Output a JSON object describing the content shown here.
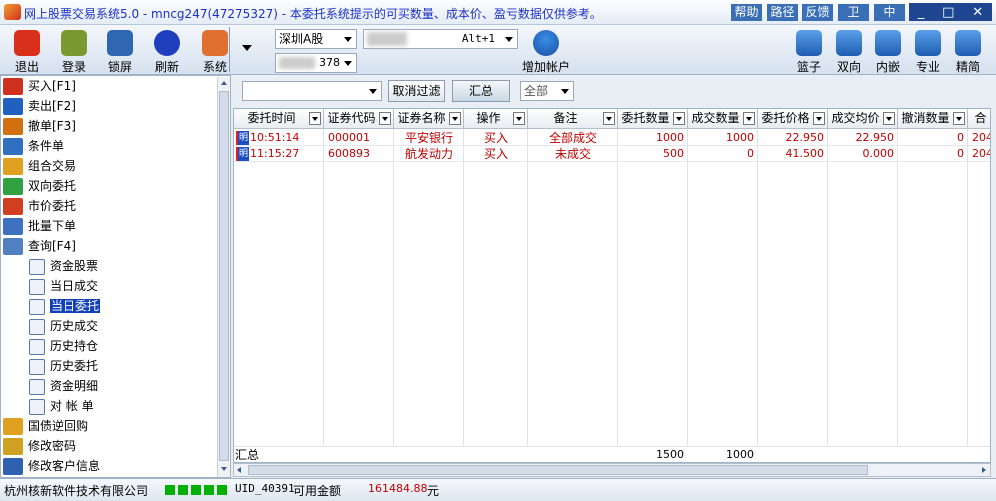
{
  "window": {
    "title": "网上股票交易系统5.0 - mncg247(47275327) - 本委托系统提示的可买数量、成本价、盈亏数据仅供参考。",
    "top_buttons": [
      "帮助",
      "路径",
      "反馈",
      "卫",
      "中"
    ],
    "controls": [
      "_",
      "□",
      "✕"
    ]
  },
  "toolbar": {
    "left": [
      {
        "label": "退出",
        "icon": "power-icon",
        "color": "#d9301c"
      },
      {
        "label": "登录",
        "icon": "users-icon",
        "color": "#7a9a30"
      },
      {
        "label": "锁屏",
        "icon": "lock-icon",
        "color": "#2f67b5"
      },
      {
        "label": "刷新",
        "icon": "refresh-icon",
        "color": "#1f3fbf"
      },
      {
        "label": "系统",
        "icon": "tools-icon",
        "color": "#e07030"
      }
    ],
    "market_select": "深圳A股",
    "account_hotkey": "Alt+1",
    "account_suffix": "378",
    "add_account": "增加帐户",
    "right": [
      {
        "label": "篮子",
        "icon": "basket-icon"
      },
      {
        "label": "双向",
        "icon": "arrows-icon"
      },
      {
        "label": "内嵌",
        "icon": "layers-icon"
      },
      {
        "label": "专业",
        "icon": "user-key-icon"
      },
      {
        "label": "精简",
        "icon": "window-icon"
      }
    ]
  },
  "sidebar": {
    "items": [
      {
        "label": "买入[F1]",
        "icon": "buy-icon",
        "color": "#d03020"
      },
      {
        "label": "卖出[F2]",
        "icon": "sell-icon",
        "color": "#2060c0"
      },
      {
        "label": "撤单[F3]",
        "icon": "hand-icon",
        "color": "#d07010"
      },
      {
        "label": "条件单",
        "icon": "note-icon",
        "color": "#3070c0"
      },
      {
        "label": "组合交易",
        "icon": "combo-icon",
        "color": "#e0a020"
      },
      {
        "label": "双向委托",
        "icon": "two-way-icon",
        "color": "#30a040"
      },
      {
        "label": "市价委托",
        "icon": "market-icon",
        "color": "#d04020"
      },
      {
        "label": "批量下单",
        "icon": "batch-icon",
        "color": "#4070c0"
      },
      {
        "label": "查询[F4]",
        "icon": "search-icon",
        "color": "#5080c0"
      }
    ],
    "sub_items": [
      "资金股票",
      "当日成交",
      "当日委托",
      "历史成交",
      "历史持仓",
      "历史委托",
      "资金明细",
      "对 帐 单"
    ],
    "active_sub": 2,
    "bottom_items": [
      {
        "label": "国债逆回购",
        "icon": "bond-icon",
        "color": "#e0a020"
      },
      {
        "label": "修改密码",
        "icon": "key-icon",
        "color": "#d0a020"
      },
      {
        "label": "修改客户信息",
        "icon": "profile-icon",
        "color": "#3060b0"
      }
    ]
  },
  "filter": {
    "value": "",
    "cancel_filter": "取消过滤",
    "summary": "汇总",
    "scope": "全部"
  },
  "table": {
    "columns": [
      "委托时间",
      "证券代码",
      "证券名称",
      "操作",
      "备注",
      "委托数量",
      "成交数量",
      "委托价格",
      "成交均价",
      "撤消数量",
      "合"
    ],
    "rows": [
      [
        "10:51:14",
        "000001",
        "平安银行",
        "买入",
        "全部成交",
        "1000",
        "1000",
        "22.950",
        "22.950",
        "0",
        "204"
      ],
      [
        "11:15:27",
        "600893",
        "航发动力",
        "买入",
        "未成交",
        "500",
        "0",
        "41.500",
        "0.000",
        "0",
        "204"
      ]
    ],
    "row_badge": "明",
    "text_color": "#c00000",
    "summary": {
      "label": "汇总",
      "order_qty": "1500",
      "deal_qty": "1000"
    }
  },
  "status": {
    "company": "杭州核新软件技术有限公司",
    "signal_bars": 5,
    "uid": "UID_40391",
    "available_label": "可用金额",
    "available_value": "161484.88",
    "unit": "元"
  }
}
